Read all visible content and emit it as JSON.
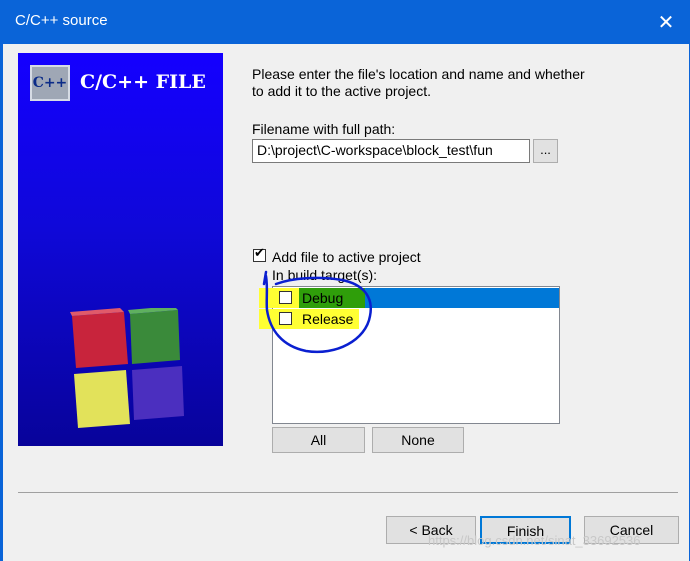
{
  "window": {
    "title": "C/C++ source",
    "close_glyph": "✕"
  },
  "banner": {
    "logo_text": "C++",
    "title": "C/C++ FILE",
    "icon": "cube-icon"
  },
  "intro": "Please enter the file's location and name and whether to add it to the active project.",
  "filename": {
    "label": "Filename with full path:",
    "value": "D:\\project\\C-workspace\\block_test\\fun",
    "browse_label": "..."
  },
  "add_to_project": {
    "label": "Add file to active project",
    "checked": true
  },
  "build_targets": {
    "label": "In build target(s):",
    "items": [
      {
        "label": "Debug",
        "checked": false,
        "selected": true
      },
      {
        "label": "Release",
        "checked": false,
        "selected": false
      }
    ]
  },
  "buttons": {
    "all": "All",
    "none": "None",
    "back": "< Back",
    "finish": "Finish",
    "cancel": "Cancel"
  },
  "watermark": "https://blog.csdn.net/sinat_33692536",
  "colors": {
    "titlebar": "#0a64d8",
    "selection": "#0078d7",
    "highlight_yellow": "#ffff33",
    "highlight_green": "#2f9e0a",
    "annotation": "#0a1fd0"
  }
}
